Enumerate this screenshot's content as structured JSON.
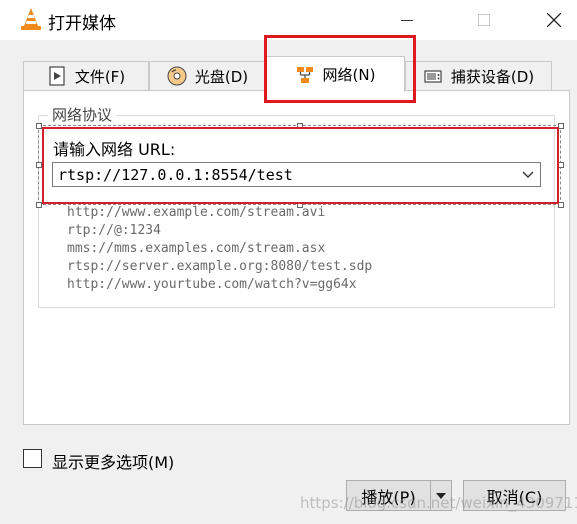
{
  "window": {
    "title": "打开媒体",
    "icon": "vlc-cone-icon"
  },
  "tabs": [
    {
      "label": "文件(F)",
      "icon": "file-play-icon",
      "active": false
    },
    {
      "label": "光盘(D)",
      "icon": "disc-icon",
      "active": false
    },
    {
      "label": "网络(N)",
      "icon": "network-icon",
      "active": true
    },
    {
      "label": "捕获设备(D)",
      "icon": "capture-device-icon",
      "active": false
    }
  ],
  "network": {
    "group_title": "网络协议",
    "url_label": "请输入网络 URL:",
    "url_value": "rtsp://127.0.0.1:8554/test",
    "examples": [
      "http://www.example.com/stream.avi",
      "rtp://@:1234",
      "mms://mms.examples.com/stream.asx",
      "rtsp://server.example.org:8080/test.sdp",
      "http://www.yourtube.com/watch?v=gg64x"
    ]
  },
  "options": {
    "show_more_label": "显示更多选项(M)",
    "checked": false
  },
  "buttons": {
    "play": "播放(P)",
    "cancel": "取消(C)"
  },
  "watermark": "https://blog.csdn.net/weixin_43097118",
  "colors": {
    "highlight": "#e0181f",
    "accent_orange": "#f08a1c"
  }
}
